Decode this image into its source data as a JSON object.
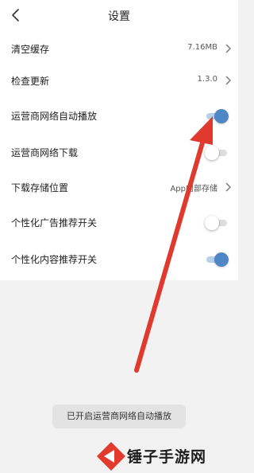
{
  "header": {
    "title": "设置"
  },
  "settings": [
    {
      "label": "清空缓存",
      "value": "7.16MB"
    },
    {
      "label": "检查更新",
      "value": "1.3.0"
    },
    {
      "label": "运营商网络自动播放",
      "toggle": "on"
    },
    {
      "label": "运营商网络下载",
      "toggle": "off"
    },
    {
      "label": "下载存储位置",
      "value": "App内部存储"
    },
    {
      "label": "个性化广告推荐开关",
      "toggle": "off"
    },
    {
      "label": "个性化内容推荐开关",
      "toggle": "on"
    }
  ],
  "toast": {
    "text": "已开启运营商网络自动播放"
  },
  "watermark": {
    "text": "锤子手游网"
  },
  "colors": {
    "accent": "#4f86c6",
    "arrow": "#e03a2f"
  }
}
